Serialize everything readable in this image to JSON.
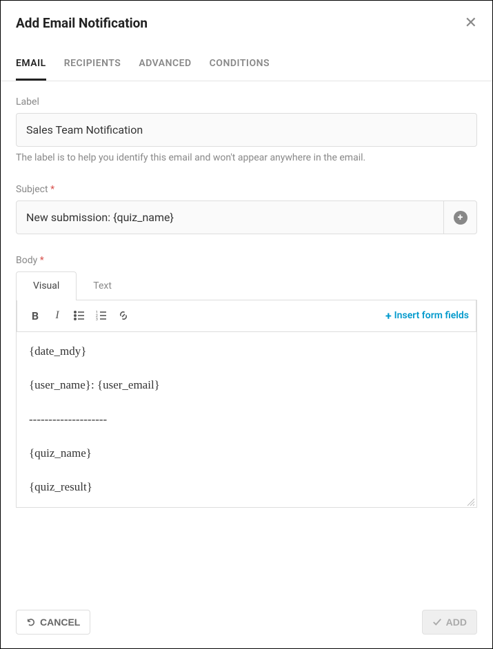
{
  "header": {
    "title": "Add Email Notification"
  },
  "tabs": [
    {
      "label": "EMAIL",
      "active": true
    },
    {
      "label": "RECIPIENTS",
      "active": false
    },
    {
      "label": "ADVANCED",
      "active": false
    },
    {
      "label": "CONDITIONS",
      "active": false
    }
  ],
  "fields": {
    "label": {
      "title": "Label",
      "value": "Sales Team Notification",
      "helper": "The label is to help you identify this email and won't appear anywhere in the email."
    },
    "subject": {
      "title": "Subject",
      "required_marker": "*",
      "value": "New submission: {quiz_name}"
    },
    "body": {
      "title": "Body",
      "required_marker": "*",
      "tabs": {
        "visual": "Visual",
        "text": "Text"
      },
      "insert_link": "Insert form fields",
      "content": "{date_mdy}\n\n{user_name}: {user_email}\n\n--------------------\n\n{quiz_name}\n\n{quiz_result}"
    }
  },
  "footer": {
    "cancel": "CANCEL",
    "add": "ADD"
  }
}
